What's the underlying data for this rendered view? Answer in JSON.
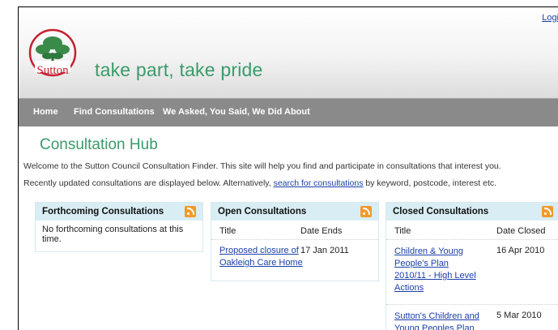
{
  "header": {
    "login_label": "Logi",
    "logo_word": "Sutton",
    "tagline": "take part, take pride"
  },
  "nav": {
    "items": [
      "Home",
      "Find Consultations",
      "We Asked, You Said, We Did",
      "About"
    ]
  },
  "main": {
    "title": "Consultation Hub",
    "intro_line1": "Welcome to the Sutton Council Consultation Finder. This site will help you find and participate in consultations that interest you.",
    "intro_line2_before": "Recently updated consultations are displayed below. Alternatively, ",
    "intro_line2_link": "search for consultations",
    "intro_line2_after": " by keyword, postcode, interest etc."
  },
  "panels": {
    "forthcoming": {
      "title": "Forthcoming Consultations",
      "empty_line1": "No forthcoming consultations at this",
      "empty_line2": "time."
    },
    "open": {
      "title": "Open Consultations",
      "col_title": "Title",
      "col_date": "Date Ends",
      "rows": [
        {
          "title_line1": "Proposed closure of",
          "title_line2": "Oakleigh Care Home",
          "date": "17 Jan 2011"
        }
      ]
    },
    "closed": {
      "title": "Closed Consultations",
      "col_title": "Title",
      "col_date": "Date Closed",
      "rows": [
        {
          "title_line1": "Children & Young",
          "title_line2": "People's Plan",
          "title_line3": "2010/11 - High Level",
          "title_line4": "Actions",
          "date": "16 Apr 2010"
        },
        {
          "title_line1": "Sutton's Children and",
          "title_line2": "Young Peoples Plan",
          "date": "5 Mar 2010"
        }
      ]
    }
  },
  "colors": {
    "brand_green": "#3a9b6a",
    "brand_red": "#c6202f",
    "nav_gray": "#8a8a8a",
    "panel_head": "#d8eef4",
    "rss_orange": "#f19a2b",
    "link_blue": "#1a3fa8"
  }
}
